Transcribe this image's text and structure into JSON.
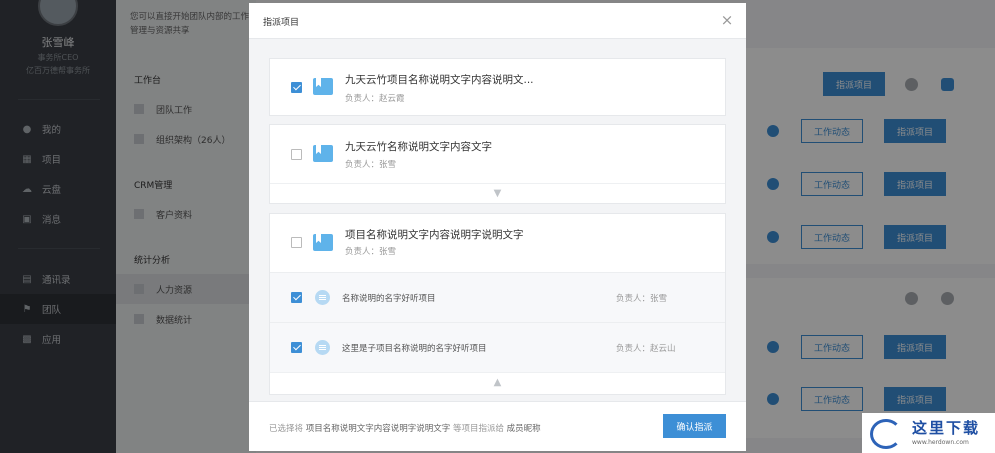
{
  "sidebar": {
    "user_name": "张雪峰",
    "user_role": "事务所CEO",
    "user_org": "亿百万德帮事务所",
    "items": [
      {
        "label": "我的",
        "icon": "person-icon"
      },
      {
        "label": "项目",
        "icon": "grid-icon"
      },
      {
        "label": "云盘",
        "icon": "cloud-icon"
      },
      {
        "label": "消息",
        "icon": "message-icon"
      },
      {
        "label": "通讯录",
        "icon": "contacts-icon"
      },
      {
        "label": "团队",
        "icon": "flag-icon"
      },
      {
        "label": "应用",
        "icon": "apps-icon"
      }
    ]
  },
  "subnav": {
    "description": "您可以直接开始团队内部的工作管理与资源共享",
    "groups": [
      {
        "title": "工作台",
        "items": [
          "团队工作",
          "组织架构（26人）"
        ]
      },
      {
        "title": "CRM管理",
        "items": [
          "客户资料"
        ]
      },
      {
        "title": "统计分析",
        "items": [
          "人力资源",
          "数据统计"
        ]
      }
    ]
  },
  "right_panel": {
    "assign_label": "指派项目",
    "activity_label": "工作动态"
  },
  "modal": {
    "title": "指派项目",
    "close": "×",
    "projects": [
      {
        "name": "九天云竹项目名称说明文字内容说明文...",
        "owner": "负责人：赵云霞",
        "checked": true
      },
      {
        "name": "九天云竹名称说明文字内容文字",
        "owner": "负责人：张雪",
        "checked": false
      },
      {
        "name": "项目名称说明文字内容说明字说明文字",
        "owner": "负责人：张雪",
        "checked": false,
        "subitems": [
          {
            "name": "名称说明的名字好听项目",
            "owner": "负责人：张雪",
            "checked": true
          },
          {
            "name": "这里是子项目名称说明的名字好听项目",
            "owner": "负责人：赵云山",
            "checked": true
          }
        ]
      }
    ],
    "footer": {
      "prefix": "已选择将",
      "project": "项目名称说明文字内容说明字说明文字",
      "middle": "等项目指派给",
      "member": "成员昵称",
      "confirm": "确认指派"
    }
  },
  "watermark": {
    "title": "这里下载",
    "url": "www.herdown.com"
  },
  "colors": {
    "accent": "#3d8fd6",
    "sidebar": "#3b3f45"
  }
}
